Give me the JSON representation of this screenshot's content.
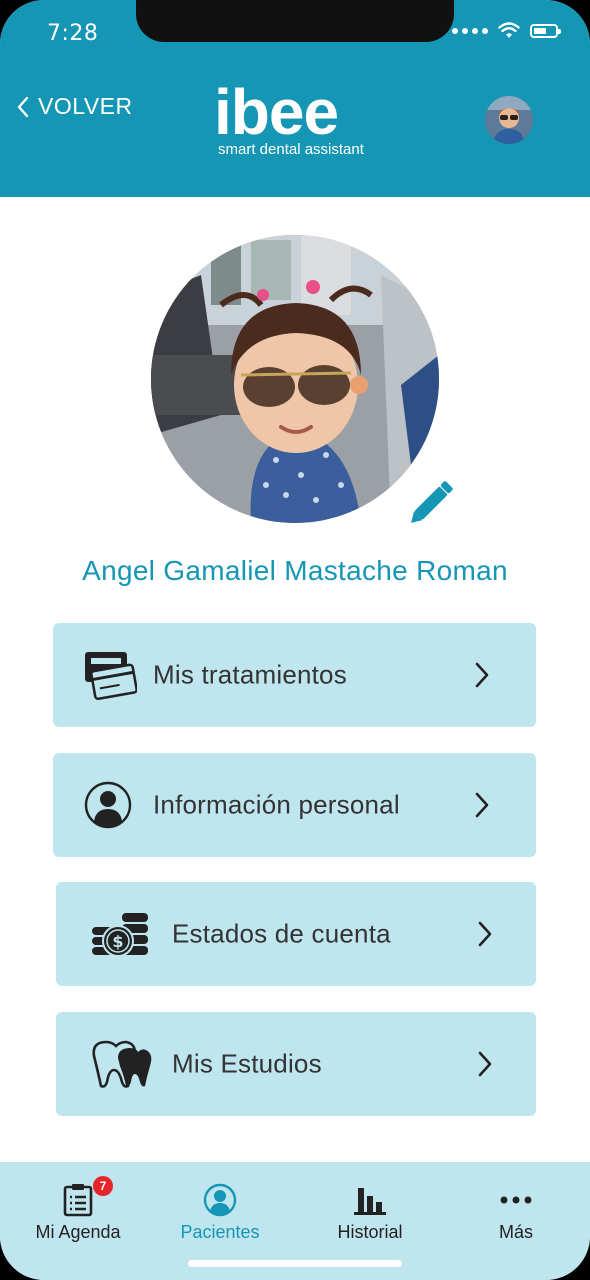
{
  "status_bar": {
    "time": "7:28"
  },
  "header": {
    "back_label": "VOLVER",
    "logo_word": "ibee",
    "logo_tagline": "smart dental assistant"
  },
  "profile": {
    "name": "Angel Gamaliel Mastache Roman"
  },
  "menu": [
    {
      "label": "Mis tratamientos",
      "icon": "payment-card-icon"
    },
    {
      "label": "Información personal",
      "icon": "user-circle-icon"
    },
    {
      "label": "Estados de cuenta",
      "icon": "coins-icon"
    },
    {
      "label": "Mis Estudios",
      "icon": "tooth-icon"
    }
  ],
  "bottom_nav": {
    "items": [
      {
        "label": "Mi Agenda",
        "icon": "agenda-icon",
        "badge": "7"
      },
      {
        "label": "Pacientes",
        "icon": "patient-icon",
        "active": true
      },
      {
        "label": "Historial",
        "icon": "bar-chart-icon"
      },
      {
        "label": "Más",
        "icon": "more-dots-icon"
      }
    ]
  },
  "colors": {
    "brand": "#1596b5",
    "card": "#bfe6ef",
    "badge": "#e8242b"
  }
}
